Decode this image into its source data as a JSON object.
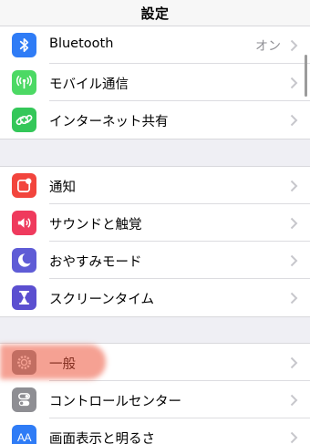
{
  "nav": {
    "title": "設定"
  },
  "colors": {
    "bluetooth": "#2f7cf6",
    "cellular": "#4cd964",
    "hotspot": "#34c759",
    "notifications": "#f2453d",
    "sounds": "#ef3a5d",
    "do_not_disturb": "#5f5cd6",
    "screen_time": "#5b4fd0",
    "general": "#8e8e93",
    "control_center": "#8e8e93",
    "display": "#2f7cf6",
    "highlight": "#ec543a"
  },
  "groups": {
    "connectivity": {
      "bluetooth": {
        "icon": "bluetooth-icon",
        "label": "Bluetooth",
        "value": "オン"
      },
      "cellular": {
        "icon": "antenna-icon",
        "label": "モバイル通信"
      },
      "hotspot": {
        "icon": "link-icon",
        "label": "インターネット共有"
      }
    },
    "alerts": {
      "notifications": {
        "icon": "notification-icon",
        "label": "通知"
      },
      "sounds": {
        "icon": "speaker-icon",
        "label": "サウンドと触覚"
      },
      "do_not_disturb": {
        "icon": "moon-icon",
        "label": "おやすみモード"
      },
      "screen_time": {
        "icon": "hourglass-icon",
        "label": "スクリーンタイム"
      }
    },
    "system": {
      "general": {
        "icon": "gear-icon",
        "label": "一般"
      },
      "control_center": {
        "icon": "toggles-icon",
        "label": "コントロールセンター"
      },
      "display": {
        "icon": "text-size-icon",
        "label": "画面表示と明るさ",
        "icon_text": "AA"
      }
    }
  }
}
